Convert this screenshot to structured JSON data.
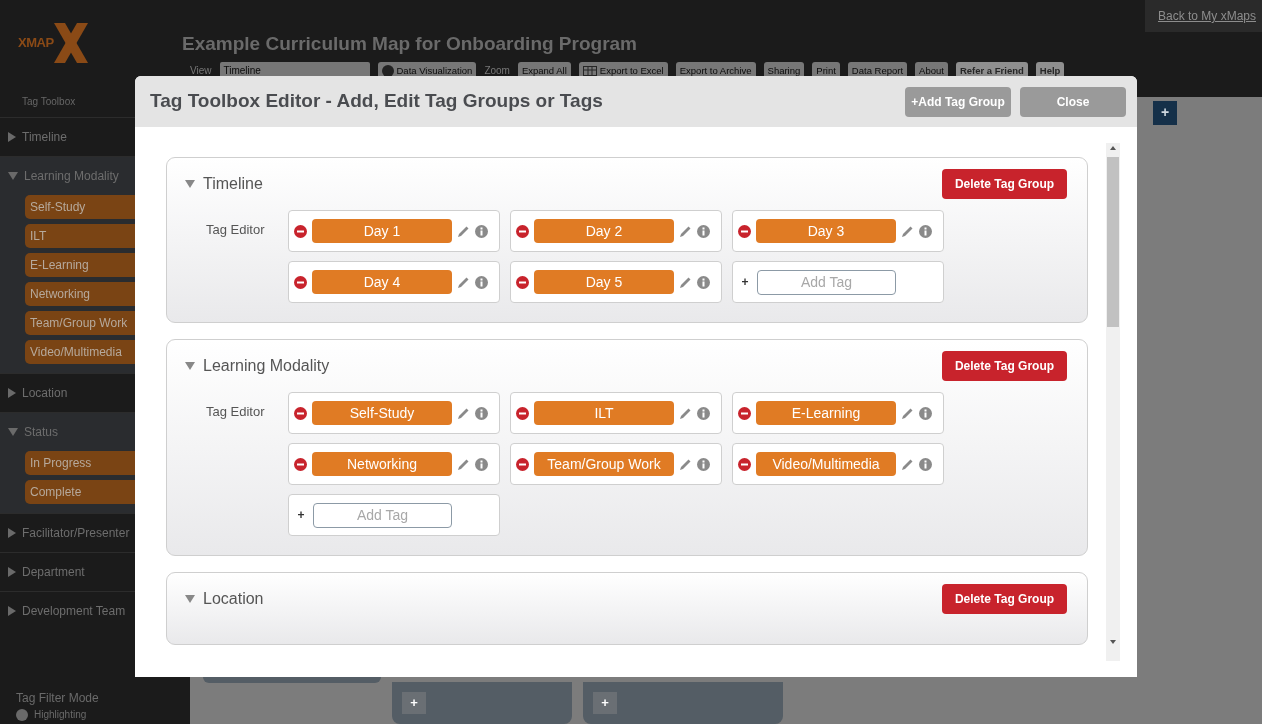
{
  "app": {
    "logo_text": "XMAP",
    "back_link": "Back to My xMaps",
    "map_title": "Example Curriculum Map for Onboarding Program",
    "toolbar": {
      "view_label": "View",
      "view_value": "Timeline",
      "visualization_toggle": "Data Visualization",
      "zoom_label": "Zoom",
      "buttons": [
        {
          "label": "Expand All",
          "kind": "plain"
        },
        {
          "label": "Export to Excel",
          "kind": "grid"
        },
        {
          "label": "Export to Archive",
          "kind": "plain"
        },
        {
          "label": "Sharing",
          "kind": "plain"
        },
        {
          "label": "Print",
          "kind": "plain"
        },
        {
          "label": "Data Report",
          "kind": "plain"
        },
        {
          "label": "About",
          "kind": "plain"
        },
        {
          "label": "Refer a Friend",
          "kind": "plain"
        },
        {
          "label": "Help",
          "kind": "plain"
        }
      ]
    },
    "add_symbols": [
      "+",
      "+",
      "+"
    ]
  },
  "sidebar": {
    "title": "Tag Toolbox",
    "groups": [
      {
        "label": "Timeline",
        "expanded": false
      },
      {
        "label": "Learning Modality",
        "expanded": true,
        "tags": [
          "Self-Study",
          "ILT",
          "E-Learning",
          "Networking",
          "Team/Group Work",
          "Video/Multimedia"
        ]
      },
      {
        "label": "Location",
        "expanded": false
      },
      {
        "label": "Status",
        "expanded": true,
        "tags": [
          "In Progress",
          "Complete"
        ]
      },
      {
        "label": "Facilitator/Presenter",
        "expanded": false
      },
      {
        "label": "Department",
        "expanded": false
      },
      {
        "label": "Development Team",
        "expanded": false
      }
    ],
    "filter_mode": {
      "label": "Tag Filter Mode",
      "option": "Highlighting"
    }
  },
  "modal": {
    "title": "Tag Toolbox Editor - Add, Edit Tag Groups or Tags",
    "add_group_button": "+Add Tag Group",
    "close_button": "Close",
    "groups": [
      {
        "name": "Timeline",
        "expanded": true,
        "delete_button": "Delete Tag Group",
        "editor_label": "Tag Editor",
        "tags": [
          "Day 1",
          "Day 2",
          "Day 3",
          "Day 4",
          "Day 5"
        ],
        "add_symbol": "+",
        "add_placeholder": "Add Tag"
      },
      {
        "name": "Learning Modality",
        "expanded": true,
        "delete_button": "Delete Tag Group",
        "editor_label": "Tag Editor",
        "tags": [
          "Self-Study",
          "ILT",
          "E-Learning",
          "Networking",
          "Team/Group Work",
          "Video/Multimedia"
        ],
        "add_symbol": "+",
        "add_placeholder": "Add Tag"
      },
      {
        "name": "Location",
        "expanded": true,
        "delete_button": "Delete Tag Group"
      }
    ]
  }
}
